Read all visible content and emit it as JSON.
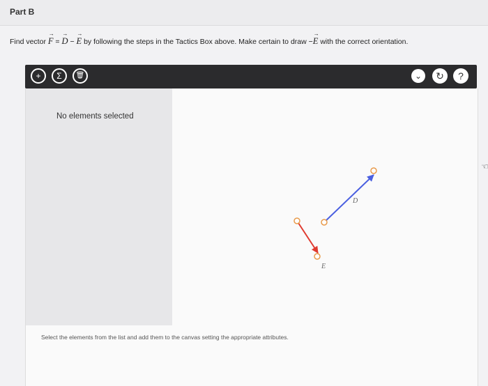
{
  "part": {
    "title": "Part B"
  },
  "instruction": {
    "find": "Find vector",
    "f": "F",
    "eq": "=",
    "d": "D",
    "minus": "−",
    "e": "E",
    "by_steps": "by following the steps in the Tactics Box above. Make certain to draw",
    "neg": "−",
    "e2": "E",
    "tail": "with the correct orientation."
  },
  "toolbar": {
    "add_symbol": "+",
    "sum_symbol": "Σ",
    "delete_symbol": "🗑",
    "dropdown_symbol": "⌄",
    "reset_symbol": "↻",
    "help_symbol": "?"
  },
  "panel": {
    "status": "No elements selected"
  },
  "canvas": {
    "vectors": [
      {
        "name": "D",
        "label": "D",
        "color": "#4a5fe0"
      },
      {
        "name": "E",
        "label": "E",
        "color": "#e03a2f"
      }
    ]
  },
  "footer": {
    "hint": "Select the elements from the list and add them to the canvas setting the appropriate attributes."
  }
}
